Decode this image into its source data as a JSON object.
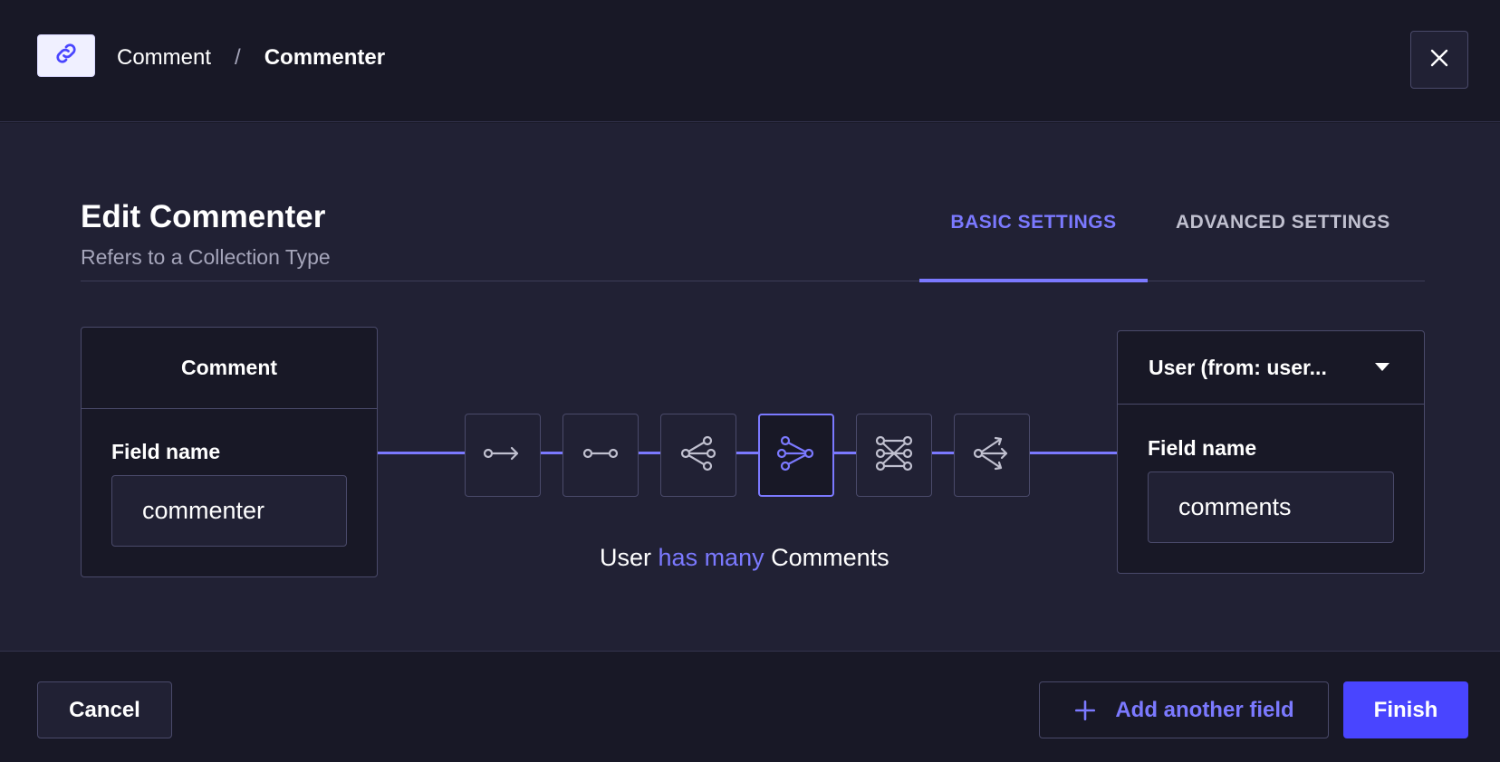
{
  "header": {
    "badge_icon": "link-icon",
    "breadcrumb_parent": "Comment",
    "breadcrumb_separator": "/",
    "breadcrumb_current": "Commenter",
    "close_icon": "close-icon"
  },
  "main": {
    "title": "Edit Commenter",
    "subtitle": "Refers to a Collection Type",
    "tabs": [
      {
        "label": "BASIC SETTINGS",
        "active": true
      },
      {
        "label": "ADVANCED SETTINGS",
        "active": false
      }
    ]
  },
  "left_card": {
    "title": "Comment",
    "field_label": "Field name",
    "field_value": "commenter"
  },
  "right_card": {
    "select_value": "User (from: user...",
    "field_label": "Field name",
    "field_value": "comments"
  },
  "relations": [
    {
      "icon": "one-way-relation-icon",
      "active": false
    },
    {
      "icon": "one-to-one-relation-icon",
      "active": false
    },
    {
      "icon": "one-to-many-relation-icon",
      "active": false
    },
    {
      "icon": "many-to-one-relation-icon",
      "active": true
    },
    {
      "icon": "many-to-many-relation-icon",
      "active": false
    },
    {
      "icon": "many-way-relation-icon",
      "active": false
    }
  ],
  "relation_text": {
    "subject": "User",
    "verb": "has many",
    "object": "Comments"
  },
  "footer": {
    "cancel_label": "Cancel",
    "add_field_label": "Add another field",
    "finish_label": "Finish"
  },
  "colors": {
    "accent": "#7b79ff",
    "primary_button": "#4945ff",
    "background": "#181826",
    "panel": "#212134"
  }
}
